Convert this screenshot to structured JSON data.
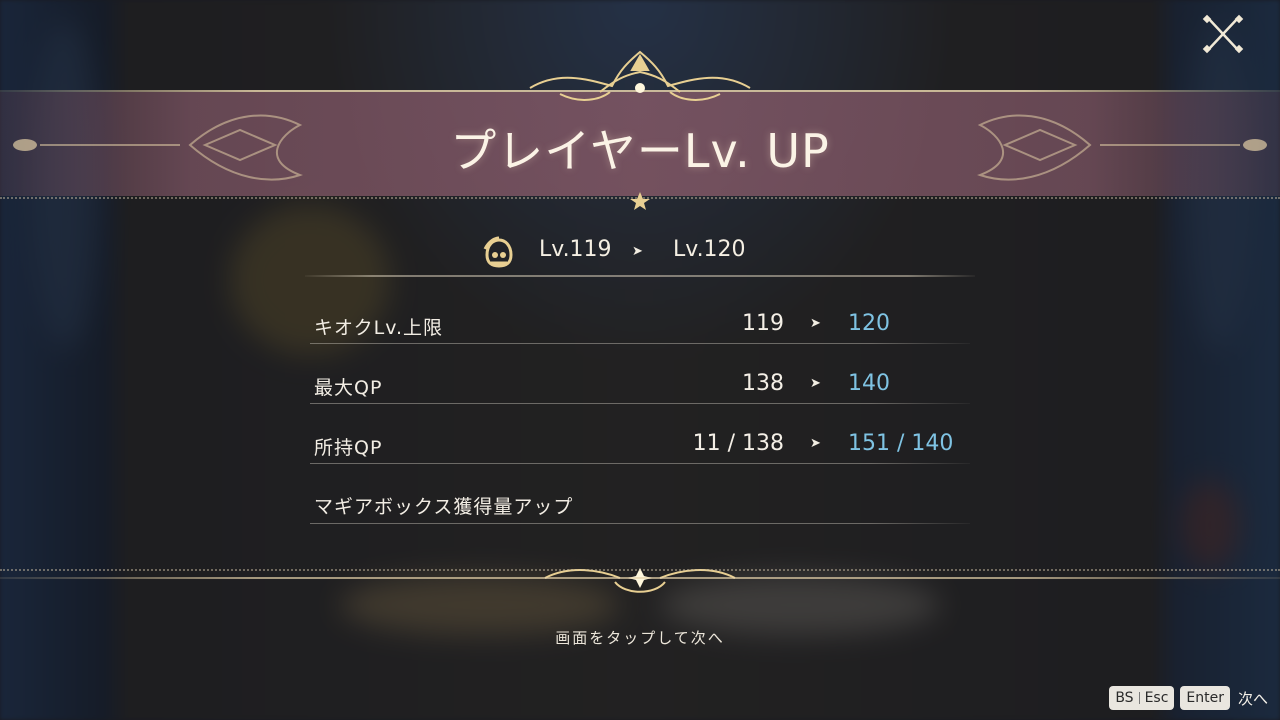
{
  "dialog": {
    "title": "プレイヤーLv. UP",
    "level": {
      "from": "Lv.119",
      "to": "Lv.120"
    },
    "stats": [
      {
        "label": "キオクLv.上限",
        "old": "119",
        "new": "120"
      },
      {
        "label": "最大QP",
        "old": "138",
        "new": "140"
      },
      {
        "label": "所持QP",
        "old": "11 / 138",
        "new": "151 / 140"
      },
      {
        "label": "マギアボックス獲得量アップ",
        "old": "",
        "new": ""
      }
    ],
    "tap_hint": "画面をタップして次へ"
  },
  "key_hints": {
    "back_key_1": "BS",
    "back_key_2": "Esc",
    "next_key": "Enter",
    "next_label": "次へ"
  },
  "icons": {
    "close": "close-icon",
    "level": "player-face-icon",
    "arrow": "arrow-right-icon"
  },
  "colors": {
    "accent_gold": "#e8cf92",
    "new_value": "#7fc3e3",
    "title_band": "#82586a"
  }
}
